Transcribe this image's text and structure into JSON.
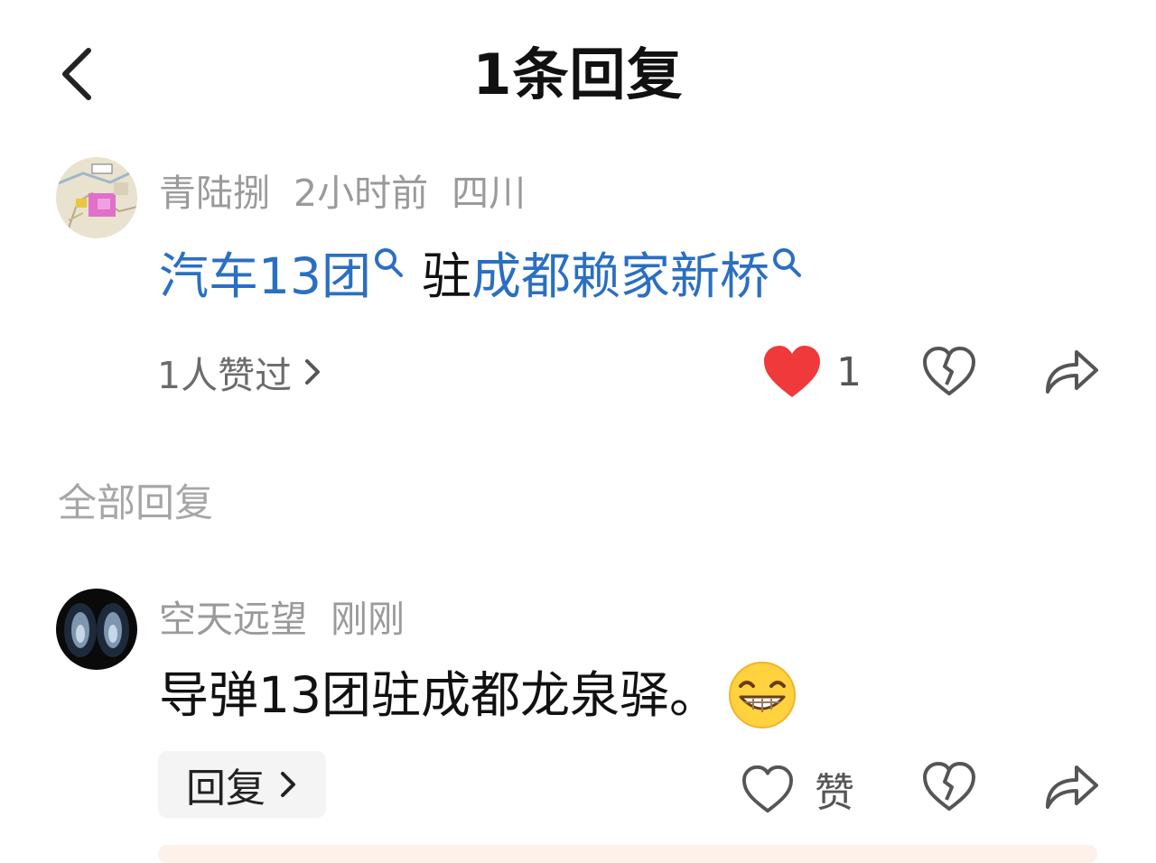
{
  "header": {
    "title": "1条回复"
  },
  "comment": {
    "username": "青陆捌",
    "time": "2小时前",
    "location": "四川",
    "text_link_1": "汽车13团",
    "text_plain": "驻",
    "text_link_2": "成都赖家新桥",
    "likes_summary": "1人赞过",
    "like_count": "1",
    "liked": true
  },
  "section": {
    "label": "全部回复"
  },
  "reply": {
    "username": "空天远望",
    "time": "刚刚",
    "text": "导弹13团驻成都龙泉驿。",
    "reply_button": "回复",
    "like_label": "赞"
  },
  "colors": {
    "link": "#2a6fc2",
    "like_red": "#f0393a",
    "muted": "#9a9a9a"
  },
  "icons": [
    "back-icon",
    "search-icon",
    "heart-filled-icon",
    "broken-heart-icon",
    "share-icon",
    "heart-outline-icon",
    "grin-emoji-icon"
  ]
}
